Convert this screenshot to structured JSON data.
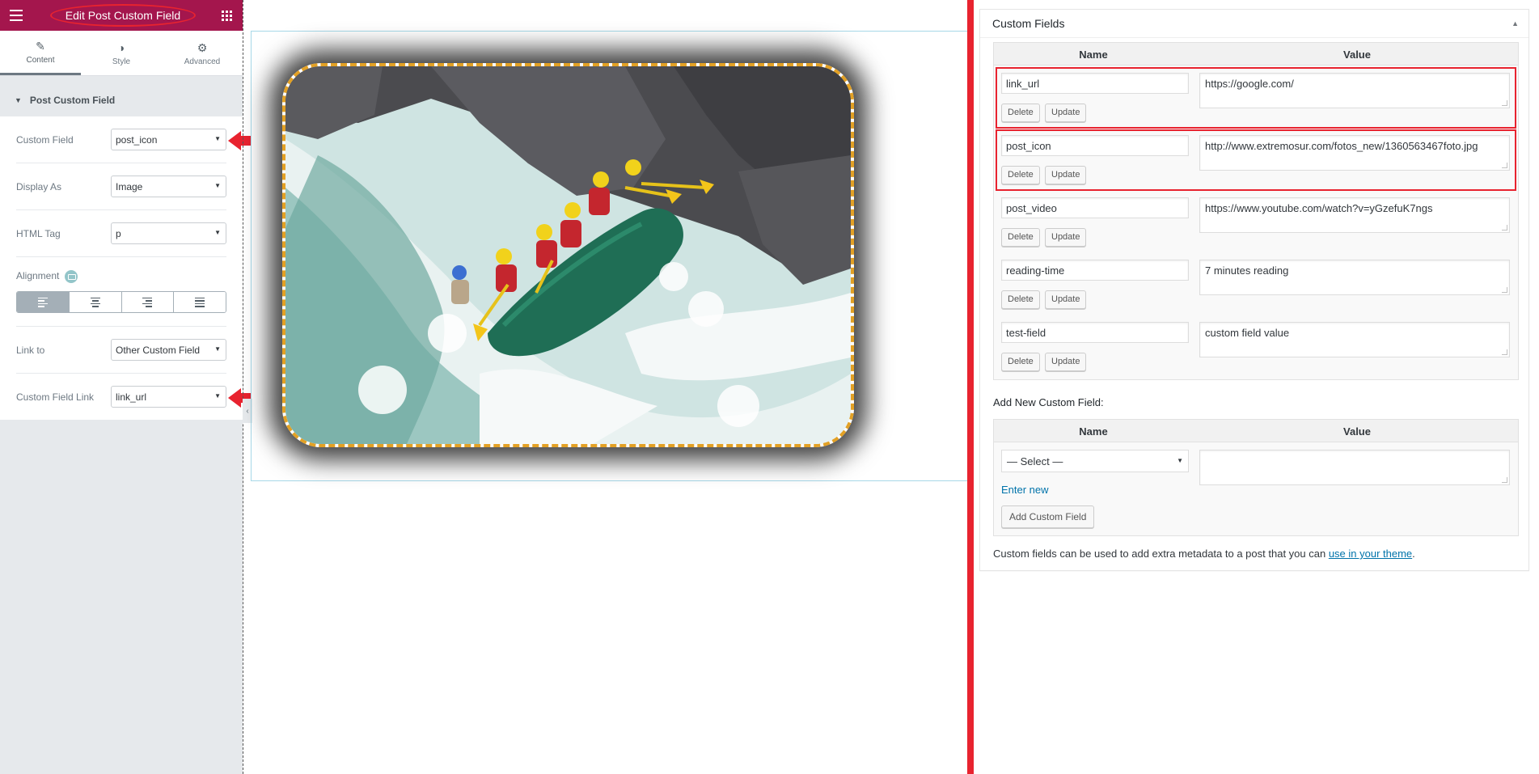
{
  "editor": {
    "title": "Edit Post Custom Field",
    "tabs": [
      {
        "label": "Content",
        "icon": "pencil-icon"
      },
      {
        "label": "Style",
        "icon": "half-circle-icon"
      },
      {
        "label": "Advanced",
        "icon": "gear-icon"
      }
    ],
    "section_title": "Post Custom Field",
    "controls": {
      "custom_field": {
        "label": "Custom Field",
        "value": "post_icon"
      },
      "display_as": {
        "label": "Display As",
        "value": "Image"
      },
      "html_tag": {
        "label": "HTML Tag",
        "value": "p"
      },
      "alignment": {
        "label": "Alignment",
        "options": [
          "left",
          "center",
          "right",
          "justify"
        ],
        "selected": "left"
      },
      "link_to": {
        "label": "Link to",
        "value": "Other Custom Field"
      },
      "custom_field_link": {
        "label": "Custom Field Link",
        "value": "link_url"
      }
    }
  },
  "preview": {
    "image_alt": "White-water rafting photo",
    "border_color": "#e3a125"
  },
  "custom_fields": {
    "title": "Custom Fields",
    "col_name": "Name",
    "col_value": "Value",
    "delete_label": "Delete",
    "update_label": "Update",
    "rows": [
      {
        "name": "link_url",
        "value": "https://google.com/"
      },
      {
        "name": "post_icon",
        "value": "http://www.extremosur.com/fotos_new/1360563467foto.jpg"
      },
      {
        "name": "post_video",
        "value": "https://www.youtube.com/watch?v=yGzefuK7ngs"
      },
      {
        "name": "reading-time",
        "value": "7 minutes reading"
      },
      {
        "name": "test-field",
        "value": "custom field value"
      }
    ],
    "add_new_title": "Add New Custom Field:",
    "select_placeholder": "— Select —",
    "enter_new": "Enter new",
    "add_button": "Add Custom Field",
    "footnote_text": "Custom fields can be used to add extra metadata to a post that you can",
    "footnote_link": "use in your theme",
    "footnote_end": "."
  },
  "colors": {
    "elementor_header": "#a4164d",
    "highlight_red": "#e8232f",
    "wp_link": "#0073aa"
  }
}
